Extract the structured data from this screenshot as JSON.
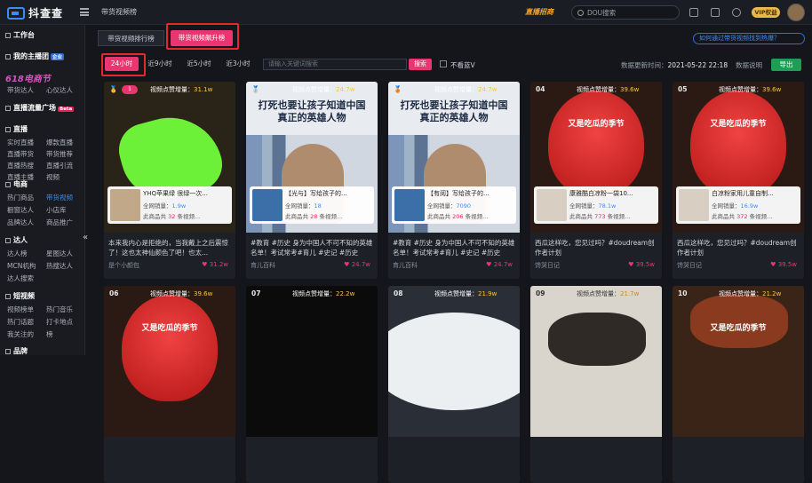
{
  "topbar": {
    "logo": "抖查查",
    "breadcrumb": "带货视频榜",
    "live_promo": "直播招商",
    "search_value": "DOU搜索",
    "vip_label": "VIP权益"
  },
  "sidebar": {
    "workbench": "工作台",
    "my_anchors": "我的主播团",
    "my_anchors_badge": "企业",
    "e_festival": "618电商节",
    "festival_items": [
      "带货达人",
      "心仪达人"
    ],
    "live_traffic": "直播流量广场",
    "live_traffic_badge": "Beta",
    "live_section": "直播",
    "live_items": [
      [
        "实时直播",
        "爆款直播"
      ],
      [
        "直播带货",
        "带货推荐"
      ],
      [
        "直播热搜",
        "直播引流"
      ],
      [
        "直播主播",
        "视频"
      ]
    ],
    "ecom_section": "电商",
    "ecom_items": [
      [
        "热门商品",
        "带货视频"
      ],
      [
        "橱窗达人",
        "小店库"
      ],
      [
        "品牌达人",
        "商品推广"
      ]
    ],
    "talent_section": "达人",
    "talent_items": [
      [
        "达人榜",
        "星图达人"
      ],
      [
        "MCN机构",
        "热搜达人"
      ],
      [
        "达人搜索",
        ""
      ]
    ],
    "short_video_section": "短视频",
    "short_video_items": [
      [
        "视频榜单",
        "热门音乐"
      ],
      [
        "热门话题",
        "打卡地点"
      ],
      [
        "我关注的",
        "榜"
      ]
    ],
    "brand_section": "品牌"
  },
  "tabs": {
    "tab1": "带货视频排行榜",
    "tab2": "带货视频飙升榜",
    "howto": "如何通过带货视频找到热爆？"
  },
  "filters": {
    "ranges": [
      "24小时",
      "近9小时",
      "近5小时",
      "近3小时"
    ],
    "selected": "24小时",
    "keyword_placeholder": "请输入关键词搜索",
    "search_btn": "搜索",
    "no_blue_v": "不看蓝V",
    "update_label": "数据更新时间：",
    "update_time": "2021-05-22 22:18",
    "data_desc": "数据说明",
    "export_label": "导出"
  },
  "accent_color": "#ea3670",
  "cards": [
    {
      "rank": "",
      "delta": "1",
      "growth_label": "视频点赞增量：",
      "growth": "31.1w",
      "product": "YHQ苹果绿 很绿一次...",
      "sales": "1.9w",
      "sales_label": "全网销量：",
      "rel_prefix": "此商品共",
      "rel_count": "32",
      "rel_suffix": "条视频...",
      "caption": "本来我内心是拒绝的，当我戴上之后震惊了！这也太神仙颜色了吧！也太...",
      "author": "是个小颜包",
      "likes": "31.2w"
    },
    {
      "rank": "",
      "delta": "",
      "growth_label": "视频点赞增量：",
      "growth": "24.7w",
      "thumb_title": "打死也要让孩子知道中国真正的英雄人物",
      "product": "【光与】写给孩子的...",
      "sales": "18",
      "sales_label": "全网销量：",
      "rel_prefix": "此商品共",
      "rel_count": "28",
      "rel_suffix": "条视频...",
      "caption": "#教育 #历史 身为中国人不可不知的英雄名单！考试常考#育儿 #史记 #历史",
      "author": "育儿百科",
      "likes": "24.7w"
    },
    {
      "rank": "",
      "delta": "",
      "growth_label": "视频点赞增量：",
      "growth": "24.7w",
      "thumb_title": "打死也要让孩子知道中国真正的英雄人物",
      "product": "【有阅】写给孩子的...",
      "sales": "7090",
      "sales_label": "全网销量：",
      "rel_prefix": "此商品共",
      "rel_count": "206",
      "rel_suffix": "条视频...",
      "caption": "#教育 #历史 身为中国人不可不知的英雄名单！考试常考#育儿 #史记 #历史",
      "author": "育儿百科",
      "likes": "24.7w"
    },
    {
      "rank": "04",
      "delta": "",
      "growth_label": "视频点赞增量：",
      "growth": "39.6w",
      "thumb_title": "又是吃瓜的季节",
      "product": "康雅酷白凉粉一袋10...",
      "sales": "78.1w",
      "sales_label": "全网销量：",
      "rel_prefix": "此商品共",
      "rel_count": "773",
      "rel_suffix": "条视频...",
      "caption": "西瓜这样吃，您见过吗？#doudream创作者计划",
      "author": "馋哭日记",
      "likes": "39.5w"
    },
    {
      "rank": "05",
      "delta": "",
      "growth_label": "视频点赞增量：",
      "growth": "39.6w",
      "thumb_title": "又是吃瓜的季节",
      "product": "白凉粉家用儿童自制...",
      "sales": "16.9w",
      "sales_label": "全网销量：",
      "rel_prefix": "此商品共",
      "rel_count": "372",
      "rel_suffix": "条视频...",
      "caption": "西瓜这样吃，您见过吗？#doudream创作者计划",
      "author": "馋哭日记",
      "likes": "39.5w"
    },
    {
      "rank": "06",
      "growth_label": "视频点赞增量：",
      "growth": "39.6w",
      "thumb_title": "又是吃瓜的季节"
    },
    {
      "rank": "07",
      "growth_label": "视频点赞增量：",
      "growth": "22.2w"
    },
    {
      "rank": "08",
      "growth_label": "视频点赞增量：",
      "growth": "21.9w"
    },
    {
      "rank": "09",
      "growth_label": "视频点赞增量：",
      "growth": "21.7w"
    },
    {
      "rank": "10",
      "growth_label": "视频点赞增量：",
      "growth": "21.2w",
      "thumb_title": "又是吃瓜的季节"
    }
  ]
}
